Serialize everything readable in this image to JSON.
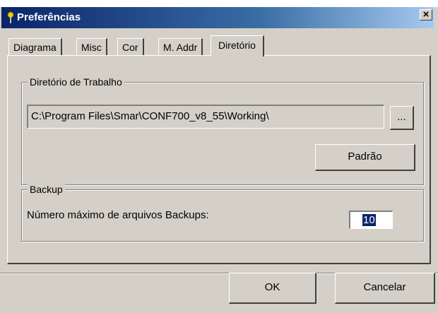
{
  "window": {
    "title": "Preferências",
    "close_glyph": "×"
  },
  "tabs": [
    {
      "label": "Diagrama"
    },
    {
      "label": "Misc"
    },
    {
      "label": "Cor"
    },
    {
      "label": "M. Addr"
    },
    {
      "label": "Diretório",
      "active": true
    }
  ],
  "working_dir": {
    "legend": "Diretório de Trabalho",
    "path": "C:\\Program Files\\Smar\\CONF700_v8_55\\Working\\",
    "browse_label": "...",
    "default_label": "Padrão"
  },
  "backup": {
    "legend": "Backup",
    "label": "Número máximo de arquivos Backups:",
    "value": "10"
  },
  "footer": {
    "ok_label": "OK",
    "cancel_label": "Cancelar"
  },
  "colors": {
    "titlebar": "#0a246a",
    "face": "#d4d0c8",
    "selection": "#0a246a"
  },
  "icons": {
    "title": "pin-icon",
    "close": "close-icon"
  }
}
